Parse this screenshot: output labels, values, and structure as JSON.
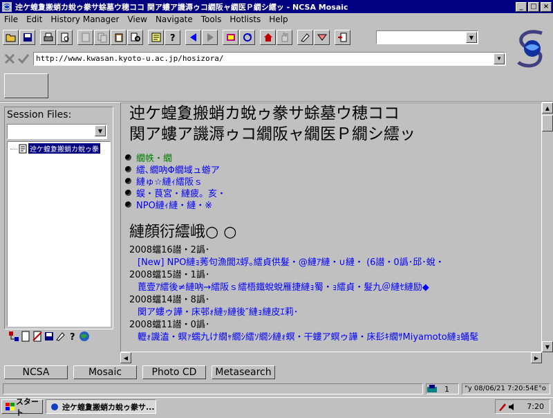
{
  "window": {
    "title": "迚ケ蝗夐搬蛸カ蛻ゥ豢サ蜍墓ウ穂ココ 関ア螻ア譏溽ゥコ繝阪ャ繝医Ｐ繝シ繧ッ - NCSA Mosaic",
    "minimize": "_",
    "maximize": "□",
    "close": "×"
  },
  "menu": [
    "File",
    "Edit",
    "History Manager",
    "View",
    "Navigate",
    "Tools",
    "Hotlists",
    "Help"
  ],
  "address": {
    "url": "http://www.kwasan.kyoto-u.ac.jp/hosizora/"
  },
  "session": {
    "label": "Session Files:",
    "tree_item": "迚ケ蝗夐搬蛸カ蛻ゥ豢"
  },
  "page": {
    "heading_line1": "迚ケ蝗夐搬蛸カ蛻ゥ豢サ蜍墓ウ穂ココ",
    "heading_line2": "関ア螻ア譏溽ゥコ繝阪ャ繝医Ｐ繝シ繧ッ",
    "nav": [
      "繝帙・繝",
      "繧､繝吶Φ繝域ュ蝣ア",
      "縺ゅ☆縺ｨ繧阪ｓ",
      "蜈・茛宮・縺疲。亥・",
      "NPO縺ｨ縺・縺・※"
    ],
    "news_heading": "縺顔衍繧峨○",
    "news": [
      {
        "date": "2008蟷16譛・2譌･",
        "item": "[New] NPO縺ｮ莠句漁閭ｽ蜉｡繧貞供髮・@縺ｱ縺・∪縺・ (6譛・0譌･邱･蛻・"
      },
      {
        "date": "2008蟷15譛・1譌･",
        "item": "蓖壹ｱ繧後≠縺吶→繧阪ｓ繧梧鐵蛻蛻雁捷縺ｮ蜀・ｮ繧貞・髮九＠縺ｾ縺励◆"
      },
      {
        "date": "2008蟷14譛・8譌･",
        "item": "関ア螻ゥ譁・床邨ｫ縺ｯ縺後″縺ｮ縺皮ｴ莉･"
      },
      {
        "date": "2008蟷11譛・0譌･",
        "item": "轣ｫ譏溘・螟ｧ蠕九け繝ｬ繝ｼ繧ｿ繝ｼ縺ｫ螟・干螻ア螟ゥ譁・床髟ｷ繝ｻMiyamoto縺ｮ蛹髦"
      }
    ]
  },
  "bottom_buttons": [
    "NCSA",
    "Mosaic",
    "Photo CD",
    "Metasearch"
  ],
  "status": {
    "count": "1",
    "datetime": "“y 08/06/21 7:20:54E°o"
  },
  "taskbar": {
    "start": "スタート",
    "task": "迚ケ蝗夐搬蛸カ蛻ゥ豢サ...",
    "clock": "7:20"
  }
}
